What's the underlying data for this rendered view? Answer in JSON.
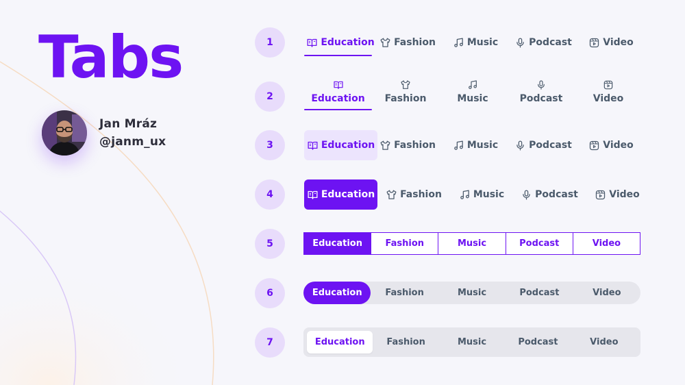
{
  "title": "Tabs",
  "author": {
    "name": "Jan Mráz",
    "handle": "@janm_ux"
  },
  "accent": "#6d13f2",
  "labels": {
    "education": "Education",
    "fashion": "Fashion",
    "music": "Music",
    "podcast": "Podcast",
    "video": "Video"
  },
  "icons": {
    "education": "book-icon",
    "fashion": "shirt-icon",
    "music": "music-note-icon",
    "podcast": "microphone-icon",
    "video": "video-play-icon"
  },
  "rows": [
    {
      "number": "1",
      "style": "underline",
      "active": "Education"
    },
    {
      "number": "2",
      "style": "stacked-underline",
      "active": "Education"
    },
    {
      "number": "3",
      "style": "light-pill",
      "active": "Education"
    },
    {
      "number": "4",
      "style": "solid-pill",
      "active": "Education"
    },
    {
      "number": "5",
      "style": "bordered-segmented",
      "active": "Education"
    },
    {
      "number": "6",
      "style": "rounded-track",
      "active": "Education"
    },
    {
      "number": "7",
      "style": "contained-white",
      "active": "Education"
    }
  ]
}
